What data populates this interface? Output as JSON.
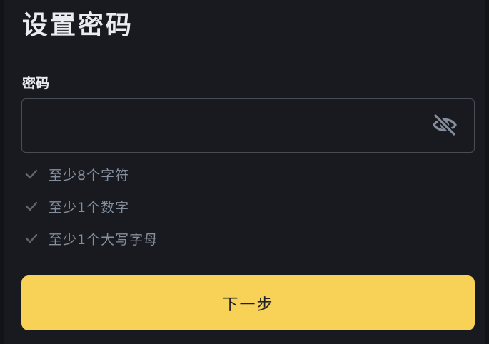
{
  "page": {
    "title": "设置密码"
  },
  "password_field": {
    "label": "密码",
    "value": "",
    "placeholder": "",
    "visibility_icon": "eye-slash-icon"
  },
  "requirements": [
    {
      "text": "至少8个字符",
      "icon": "check-icon"
    },
    {
      "text": "至少1个数字",
      "icon": "check-icon"
    },
    {
      "text": "至少1个大写字母",
      "icon": "check-icon"
    }
  ],
  "next_button": {
    "label": "下一步"
  },
  "colors": {
    "background": "#181a20",
    "accent": "#f7d257",
    "border": "#474d57",
    "muted_text": "#848e9c"
  }
}
